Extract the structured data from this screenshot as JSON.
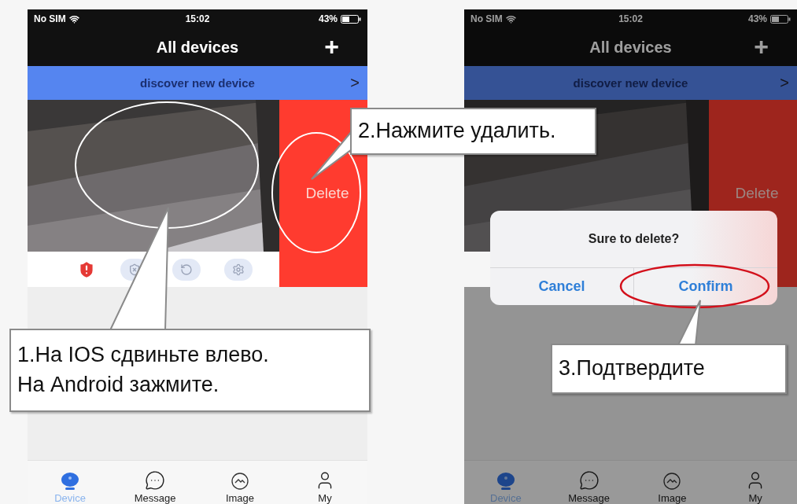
{
  "phones": [
    {
      "status_bar": {
        "carrier": "No SIM",
        "time": "15:02",
        "battery": "43%"
      },
      "title": "All devices",
      "add_button": "+",
      "banner": {
        "text": "discover new device",
        "chevron": ">"
      },
      "delete_button": "Delete",
      "dimmed": false,
      "tabs": [
        {
          "label": "Device",
          "selected": true
        },
        {
          "label": "Message",
          "selected": false
        },
        {
          "label": "Image",
          "selected": false
        },
        {
          "label": "My",
          "selected": false
        }
      ]
    },
    {
      "status_bar": {
        "carrier": "No SIM",
        "time": "15:02",
        "battery": "43%"
      },
      "title": "All devices",
      "add_button": "+",
      "banner": {
        "text": "discover new device",
        "chevron": ">"
      },
      "delete_button": "Delete",
      "dimmed": true,
      "dialog": {
        "title": "Sure to delete?",
        "buttons": [
          "Cancel",
          "Confirm"
        ]
      },
      "tabs": [
        {
          "label": "Device",
          "selected": true
        },
        {
          "label": "Message",
          "selected": false
        },
        {
          "label": "Image",
          "selected": false
        },
        {
          "label": "My",
          "selected": false
        }
      ]
    }
  ],
  "callouts": [
    {
      "lines": [
        "1.На IOS сдвиньте влево.",
        "На Android зажмите."
      ]
    },
    {
      "lines": [
        "2.Нажмите удалить."
      ]
    },
    {
      "lines": [
        "3.Подтвердите"
      ]
    }
  ]
}
